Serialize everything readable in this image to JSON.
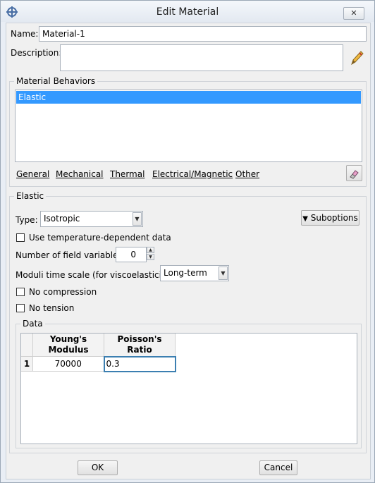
{
  "window": {
    "title": "Edit Material",
    "close_glyph": "✕",
    "app_icon": "abaqus-app-icon",
    "close_icon": "close-icon"
  },
  "form": {
    "name_label": "Name:",
    "name_value": "Material-1",
    "description_label": "Description:",
    "description_value": "",
    "edit_icon": "pencil-icon"
  },
  "behaviors": {
    "title": "Material Behaviors",
    "items": [
      "Elastic"
    ],
    "selected": "Elastic"
  },
  "menu": {
    "items": [
      {
        "label": "General"
      },
      {
        "label": "Mechanical"
      },
      {
        "label": "Thermal"
      },
      {
        "label": "Electrical/Magnetic"
      },
      {
        "label": "Other"
      }
    ],
    "delete_icon": "eraser-icon"
  },
  "elastic": {
    "title": "Elastic",
    "type_label": "Type:",
    "type_value": "Isotropic",
    "suboptions_label": "Suboptions",
    "temp_dependent_label": "Use temperature-dependent data",
    "field_vars_label": "Number of field variables:",
    "field_vars_value": "0",
    "moduli_label": "Moduli time scale (for viscoelasticity):",
    "moduli_value": "Long-term",
    "no_compression_label": "No compression",
    "no_tension_label": "No tension"
  },
  "data": {
    "title": "Data",
    "columns": [
      {
        "line1": "Young's",
        "line2": "Modulus"
      },
      {
        "line1": "Poisson's",
        "line2": "Ratio"
      }
    ],
    "rows": [
      {
        "index": "1",
        "youngs": "70000",
        "poisson": "0.3"
      }
    ]
  },
  "buttons": {
    "ok": "OK",
    "cancel": "Cancel"
  },
  "colors": {
    "selection": "#3399ff",
    "window_bg": "#f0f0f0",
    "frame": "#e9eef5"
  }
}
